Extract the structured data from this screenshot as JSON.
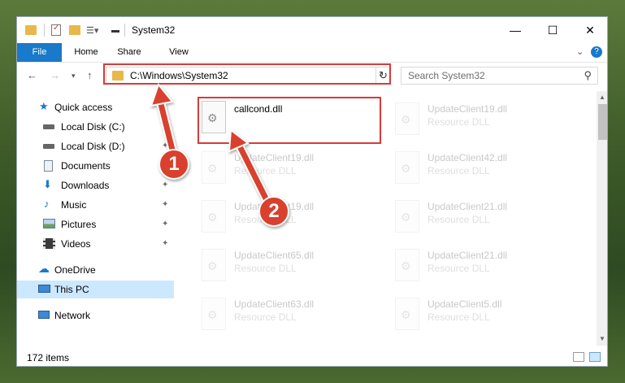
{
  "window": {
    "title": "System32",
    "controls": {
      "minimize": "—",
      "maximize": "☐",
      "close": "✕"
    }
  },
  "ribbon": {
    "tabs": [
      "File",
      "Home",
      "Share",
      "View"
    ],
    "expand_icon": "chevron-down-icon",
    "help_label": "?"
  },
  "navigation": {
    "back_icon": "arrow-left-icon",
    "forward_icon": "arrow-right-icon",
    "recent_icon": "chevron-down-icon",
    "up_icon": "arrow-up-icon",
    "address": "C:\\Windows\\System32",
    "search_placeholder": "Search System32"
  },
  "sidebar": {
    "items": [
      {
        "label": "Quick access",
        "icon": "star-icon",
        "pinned": false
      },
      {
        "label": "Local Disk (C:)",
        "icon": "drive-icon",
        "pinned": true
      },
      {
        "label": "Local Disk (D:)",
        "icon": "drive-icon",
        "pinned": true
      },
      {
        "label": "Documents",
        "icon": "documents-icon",
        "pinned": true
      },
      {
        "label": "Downloads",
        "icon": "download-icon",
        "pinned": true
      },
      {
        "label": "Music",
        "icon": "music-icon",
        "pinned": true
      },
      {
        "label": "Pictures",
        "icon": "pictures-icon",
        "pinned": true
      },
      {
        "label": "Videos",
        "icon": "videos-icon",
        "pinned": true
      },
      {
        "label": "OneDrive",
        "icon": "cloud-icon",
        "pinned": false
      },
      {
        "label": "This PC",
        "icon": "computer-icon",
        "pinned": false,
        "selected": true
      },
      {
        "label": "Network",
        "icon": "network-icon",
        "pinned": false
      }
    ]
  },
  "files": {
    "column1": [
      {
        "name": "callcond.dll",
        "type": ""
      },
      {
        "name": "UpdateClient19.dll",
        "type": "Resource DLL"
      },
      {
        "name": "UpdateClient19.dll",
        "type": "Resource DLL"
      },
      {
        "name": "UpdateClient65.dll",
        "type": "Resource DLL"
      },
      {
        "name": "UpdateClient63.dll",
        "type": "Resource DLL"
      }
    ],
    "column2": [
      {
        "name": "UpdateClient19.dll",
        "type": "Resource DLL"
      },
      {
        "name": "UpdateClient42.dll",
        "type": "Resource DLL"
      },
      {
        "name": "UpdateClient21.dll",
        "type": "Resource DLL"
      },
      {
        "name": "UpdateClient21.dll",
        "type": "Resource DLL"
      },
      {
        "name": "UpdateClient5.dll",
        "type": "Resource DLL"
      }
    ]
  },
  "status": {
    "item_count": "172 items"
  },
  "annotations": {
    "step1": "1",
    "step2": "2",
    "color": "#d9402e"
  },
  "colors": {
    "accent": "#1979ca",
    "highlight": "#d83a3a",
    "selected": "#cce8ff"
  }
}
